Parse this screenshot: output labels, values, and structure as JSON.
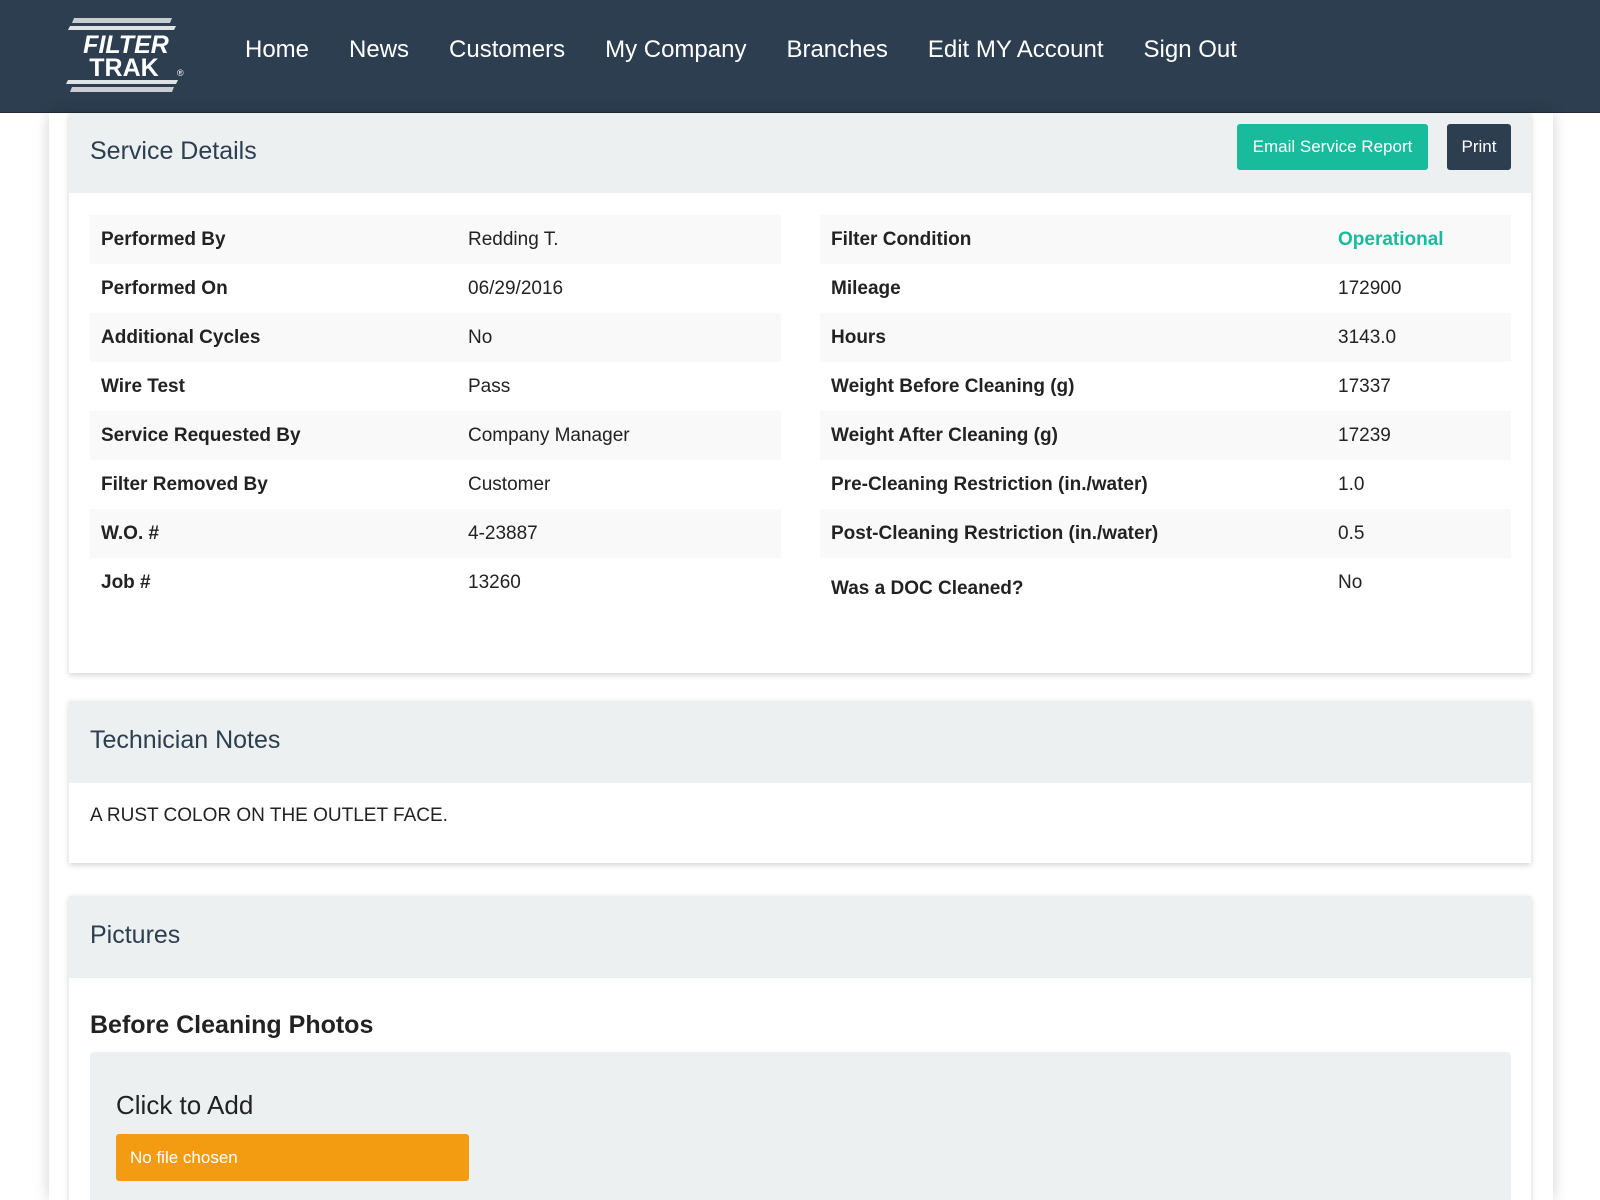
{
  "brand": {
    "line1": "FILTER",
    "line2": "TRAK",
    "registered": "®"
  },
  "nav": [
    "Home",
    "News",
    "Customers",
    "My Company",
    "Branches",
    "Edit MY Account",
    "Sign Out"
  ],
  "service_details": {
    "title": "Service Details",
    "email_button": "Email Service Report",
    "print_button": "Print",
    "left": [
      {
        "label": "Performed By",
        "value": "Redding T."
      },
      {
        "label": "Performed On",
        "value": "06/29/2016"
      },
      {
        "label": "Additional Cycles",
        "value": "No"
      },
      {
        "label": "Wire Test",
        "value": "Pass"
      },
      {
        "label": "Service Requested By",
        "value": "Company Manager"
      },
      {
        "label": "Filter Removed By",
        "value": "Customer"
      },
      {
        "label": "W.O. #",
        "value": "4-23887"
      },
      {
        "label": "Job #",
        "value": "13260"
      }
    ],
    "right": [
      {
        "label": "Filter Condition",
        "value": "Operational"
      },
      {
        "label": "Mileage",
        "value": "172900"
      },
      {
        "label": "Hours",
        "value": "3143.0"
      },
      {
        "label": "Weight Before Cleaning (g)",
        "value": "17337"
      },
      {
        "label": "Weight After Cleaning (g)",
        "value": "17239"
      },
      {
        "label": "Pre-Cleaning Restriction (in./water)",
        "value": "1.0"
      },
      {
        "label": "Post-Cleaning Restriction (in./water)",
        "value": "0.5"
      },
      {
        "label": "Was a DOC Cleaned?",
        "value": "No"
      }
    ]
  },
  "technician_notes": {
    "title": "Technician Notes",
    "text": "A RUST COLOR ON THE OUTLET FACE."
  },
  "pictures": {
    "title": "Pictures",
    "before_title": "Before Cleaning Photos",
    "click_to_add": "Click to Add",
    "file_button": "No file chosen"
  },
  "colors": {
    "navbar": "#2c3e50",
    "success": "#18bc9c",
    "warning": "#f39c12",
    "panel_heading": "#ecf0f1"
  }
}
